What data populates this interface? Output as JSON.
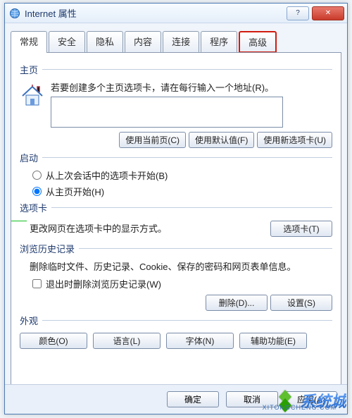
{
  "window": {
    "title": "Internet 属性"
  },
  "tabs": {
    "list": [
      {
        "id": "general",
        "label": "常规"
      },
      {
        "id": "security",
        "label": "安全"
      },
      {
        "id": "privacy",
        "label": "隐私"
      },
      {
        "id": "content",
        "label": "内容"
      },
      {
        "id": "connections",
        "label": "连接"
      },
      {
        "id": "programs",
        "label": "程序"
      },
      {
        "id": "advanced",
        "label": "高级"
      }
    ],
    "active": "general",
    "highlighted": "advanced"
  },
  "home": {
    "group": "主页",
    "intro": "若要创建多个主页选项卡，请在每行输入一个地址(R)。",
    "textarea_value": "",
    "btn_current": "使用当前页(C)",
    "btn_default": "使用默认值(F)",
    "btn_newtab": "使用新选项卡(U)"
  },
  "startup": {
    "group": "启动",
    "radio_last": "从上次会话中的选项卡开始(B)",
    "radio_home": "从主页开始(H)",
    "selected": "home"
  },
  "tabs_section": {
    "group": "选项卡",
    "line": "更改网页在选项卡中的显示方式。",
    "btn": "选项卡(T)"
  },
  "history": {
    "group": "浏览历史记录",
    "line": "删除临时文件、历史记录、Cookie、保存的密码和网页表单信息。",
    "check": "退出时删除浏览历史记录(W)",
    "checked": false,
    "btn_delete": "删除(D)...",
    "btn_settings": "设置(S)"
  },
  "appearance": {
    "group": "外观",
    "btn_color": "颜色(O)",
    "btn_lang": "语言(L)",
    "btn_font": "字体(N)",
    "btn_access": "辅助功能(E)"
  },
  "footer": {
    "ok": "确定",
    "cancel": "取消",
    "apply": "应用(A)"
  },
  "watermark": {
    "text": "系统城",
    "sub": "XITONGCHENG.COM"
  }
}
